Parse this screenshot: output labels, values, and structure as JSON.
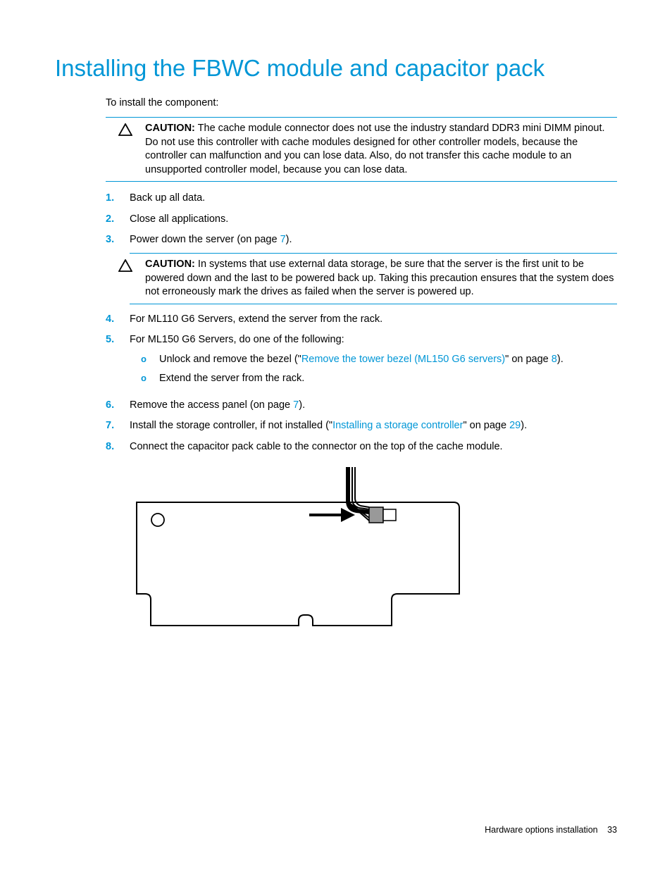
{
  "title": "Installing the FBWC module and capacitor pack",
  "intro": "To install the component:",
  "caution1": {
    "label": "CAUTION:",
    "text": "The cache module connector does not use the industry standard DDR3 mini DIMM pinout. Do not use this controller with cache modules designed for other controller models, because the controller can malfunction and you can lose data. Also, do not transfer this cache module to an unsupported controller model, because you can lose data."
  },
  "steps": [
    {
      "num": "1.",
      "text": "Back up all data."
    },
    {
      "num": "2.",
      "text": "Close all applications."
    },
    {
      "num": "3.",
      "text_pre": "Power down the server (on page ",
      "link": "7",
      "text_post": ")."
    }
  ],
  "caution2": {
    "label": "CAUTION:",
    "text": "In systems that use external data storage, be sure that the server is the first unit to be powered down and the last to be powered back up. Taking this precaution ensures that the system does not erroneously mark the drives as failed when the server is powered up."
  },
  "steps2": [
    {
      "num": "4.",
      "text": "For ML110 G6 Servers, extend the server from the rack."
    },
    {
      "num": "5.",
      "text": "For ML150 G6 Servers, do one of the following:",
      "sub": [
        {
          "bullet": "o",
          "pre": "Unlock and remove the bezel (",
          "q1": "\"",
          "link": "Remove the tower bezel (ML150 G6 servers)",
          "q2": "\"",
          "mid": " on page ",
          "page": "8",
          "post": ")."
        },
        {
          "bullet": "o",
          "text": "Extend the server from the rack."
        }
      ]
    },
    {
      "num": "6.",
      "text_pre": "Remove the access panel (on page ",
      "link": "7",
      "text_post": ")."
    },
    {
      "num": "7.",
      "text_pre": "Install the storage controller, if not installed (",
      "q1": "\"",
      "link": "Installing a storage controller",
      "q2": "\"",
      "mid": " on page ",
      "page": "29",
      "text_post": ")."
    },
    {
      "num": "8.",
      "text": "Connect the capacitor pack cable to the connector on the top of the cache module."
    }
  ],
  "footer": {
    "section": "Hardware options installation",
    "page": "33"
  }
}
